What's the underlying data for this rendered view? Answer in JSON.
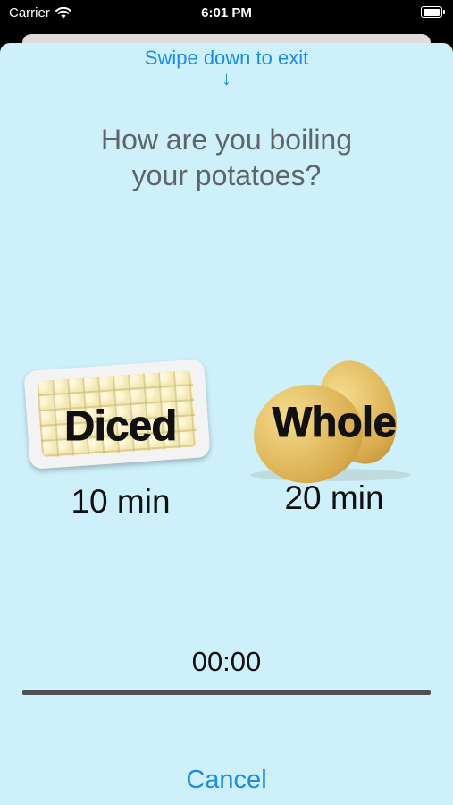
{
  "status_bar": {
    "carrier": "Carrier",
    "time": "6:01 PM",
    "icons": [
      "wifi-icon",
      "battery-icon"
    ]
  },
  "sheet": {
    "swipe_hint": "Swipe down to exit",
    "swipe_arrow": "↓",
    "question_line1": "How are you boiling",
    "question_line2": "your potatoes?"
  },
  "options": [
    {
      "label": "Diced",
      "time": "10 min",
      "image": "diced-potatoes-tray"
    },
    {
      "label": "Whole",
      "time": "20 min",
      "image": "whole-potatoes"
    }
  ],
  "timer": {
    "display": "00:00",
    "progress": 0
  },
  "cancel_label": "Cancel",
  "colors": {
    "sheet_background": "#cdf0fb",
    "accent": "#1a8ce6",
    "question_text": "#5f6468",
    "progress_track": "#4d4f52"
  }
}
